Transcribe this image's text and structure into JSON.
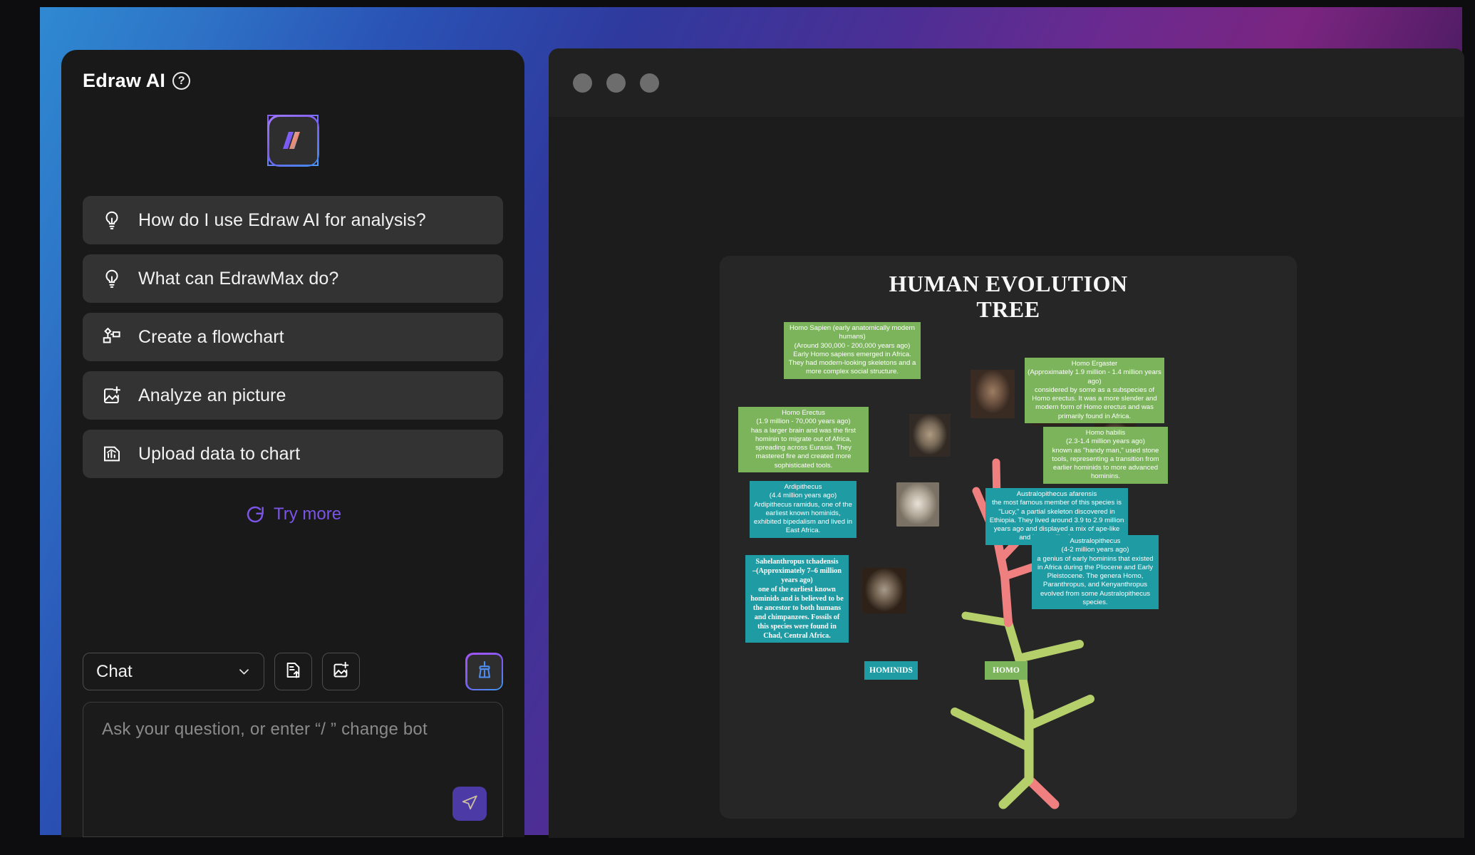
{
  "chat": {
    "title": "Edraw AI",
    "help_icon": "question-mark-icon",
    "logo_icon": "edraw-logo",
    "suggestions": [
      {
        "label": "How do I use Edraw AI for analysis?",
        "icon": "lightbulb-icon"
      },
      {
        "label": "What can EdrawMax do?",
        "icon": "lightbulb-icon"
      },
      {
        "label": "Create a flowchart",
        "icon": "flowchart-icon"
      },
      {
        "label": "Analyze an picture",
        "icon": "image-add-icon"
      },
      {
        "label": "Upload data to chart",
        "icon": "chart-file-icon"
      }
    ],
    "try_more": {
      "label": "Try more",
      "icon": "refresh-icon",
      "color": "#7b54e8"
    },
    "composer": {
      "model_value": "Chat",
      "model_options": [
        "Chat"
      ],
      "chevron_icon": "chevron-down-icon",
      "upload_file_icon": "file-upload-icon",
      "upload_image_icon": "image-add-icon",
      "clear_icon": "broom-icon",
      "input_placeholder": "Ask your question, or enter  “/  ” change bot",
      "input_value": "",
      "send_icon": "send-icon"
    }
  },
  "document_window": {
    "traffic_lights": [
      "close-dot",
      "minimize-dot",
      "maximize-dot"
    ]
  },
  "chart_data": {
    "type": "diagram",
    "title": "HUMAN EVOLUTION TREE",
    "title_lines": [
      "HUMAN EVOLUTION",
      "TREE"
    ],
    "colors": {
      "green": "#7cb45c",
      "teal": "#1f9ca3",
      "branch_pink": "#f08080",
      "branch_green": "#b5cf6b",
      "canvas": "#262626"
    },
    "bottom_labels": [
      {
        "label": "HOMINIDS",
        "color": "#1f9ca3"
      },
      {
        "label": "HOMO",
        "color": "#7cb45c"
      }
    ],
    "nodes": [
      {
        "id": "homo-sapien",
        "group": "green",
        "name": "Homo Sapien (early anatomically modern humans)",
        "age": "(Around 300,000 - 200,000 years ago)",
        "description": "Early Homo sapiens emerged in Africa. They had modern-looking skeletons and a more complex social structure.",
        "text": "Homo Sapien (early anatomically modern humans)\n(Around 300,000 - 200,000 years ago)\nEarly Homo sapiens emerged in Africa. They had modern-looking skeletons and a more complex social structure."
      },
      {
        "id": "homo-ergaster",
        "group": "green",
        "name": "Homo Ergaster",
        "age": "(Approximately 1.9 million - 1.4 million years ago)",
        "description": "considered by some as a subspecies of Homo erectus. It was a more slender and modern form of Homo erectus and was primarily found in Africa.",
        "text": "Homo Ergaster\n(Approximately 1.9 million - 1.4 million years ago)\nconsidered by some as a subspecies of Homo erectus. It was a more slender and modern form of Homo erectus and was primarily found in Africa."
      },
      {
        "id": "homo-erectus",
        "group": "green",
        "name": "Homo Erectus",
        "age": "(1.9 million - 70,000 years ago)",
        "description": "has a larger brain and was the first hominin to migrate out of Africa, spreading across Eurasia. They mastered fire and created more sophisticated tools.",
        "text": "Homo Erectus\n(1.9 million - 70,000 years ago)\nhas a larger brain and was the first hominin to migrate out of Africa, spreading across Eurasia. They mastered fire and created more sophisticated tools."
      },
      {
        "id": "homo-habilis",
        "group": "green",
        "name": "Homo habilis",
        "age": "(2.3-1.4 million years ago)",
        "description": "known as \"handy man,\" used stone tools, representing a transition from earlier hominids to more advanced hominins.",
        "text": "Homo habilis\n(2.3-1.4 million years ago)\nknown as \"handy man,\" used stone tools, representing a transition from earlier hominids to more advanced hominins."
      },
      {
        "id": "ardipithecus",
        "group": "teal",
        "name": "Ardipithecus",
        "age": "(4.4 million years ago)",
        "description": "Ardipithecus ramidus, one of the earliest known hominids, exhibited bipedalism and lived in East Africa.",
        "text": "Ardipithecus\n(4.4 million years ago)\nArdipithecus ramidus, one of the earliest known hominids, exhibited bipedalism and lived in East Africa."
      },
      {
        "id": "australopithecus-afarensis",
        "group": "teal",
        "name": "Australopithecus afarensis",
        "age": "",
        "description": "the most famous member of this species is \"Lucy,\" a partial skeleton discovered in Ethiopia. They lived around 3.9 to 2.9 million years ago and displayed a mix of ape-like and human-like features.",
        "text": "Australopithecus afarensis\nthe most famous member of this species is \"Lucy,\" a partial skeleton discovered in Ethiopia. They lived around 3.9 to 2.9 million years ago and displayed a mix of ape-like and human-like features."
      },
      {
        "id": "australopithecus",
        "group": "teal",
        "name": "Australopithecus",
        "age": "(4-2 million years ago)",
        "description": "a genius of early hominins that existed in Africa during the Pliocene and Early Pleistocene. The genera Homo, Paranthropus, and Kenyanthropus evolved from some Australopithecus species.",
        "text": "Australopithecus\n(4-2 million years ago)\na genius of early hominins that existed in Africa during the Pliocene and Early Pleistocene. The genera Homo, Paranthropus, and Kenyanthropus evolved from some Australopithecus species."
      },
      {
        "id": "sahelanthropus-tchadensis",
        "group": "teal",
        "name": "Sahelanthropus tchadensis",
        "age": "–(Approximately 7–6 million years ago)",
        "description": "one of the earliest known hominids and is believed to be the ancestor to both humans and chimpanzees. Fossils of this species were found in Chad, Central Africa.",
        "text": "Sahelanthropus tchadensis\n–(Approximately 7–6 million years ago)\none of the earliest known hominids and is believed to be the ancestor to both humans and chimpanzees. Fossils of this species were found in Chad, Central Africa."
      }
    ]
  }
}
